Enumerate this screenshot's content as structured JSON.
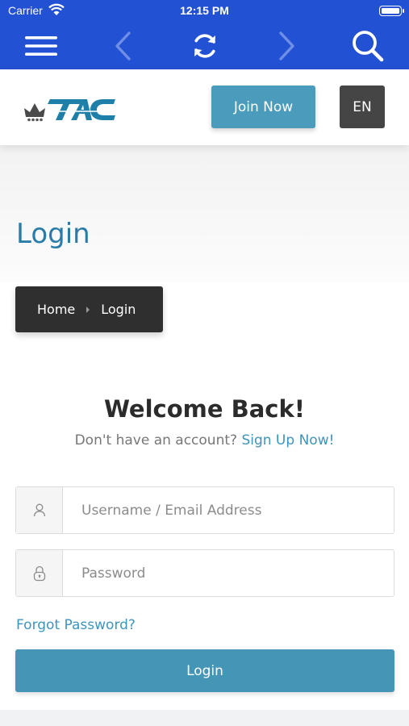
{
  "status_bar": {
    "carrier": "Carrier",
    "time": "12:15 PM"
  },
  "toolbar": {
    "icons": [
      "menu-icon",
      "back-icon",
      "refresh-icon",
      "forward-icon",
      "search-icon"
    ]
  },
  "header": {
    "logo_text": "TAC",
    "join_label": "Join Now",
    "language": "EN"
  },
  "banner": {
    "title": "Login",
    "breadcrumb": {
      "home": "Home",
      "current": "Login"
    }
  },
  "login": {
    "heading": "Welcome Back!",
    "prompt": "Don't have an account?",
    "signup_link": "Sign Up Now!",
    "username_placeholder": "Username / Email Address",
    "password_placeholder": "Password",
    "forgot_link": "Forgot Password?",
    "submit_label": "Login"
  },
  "colors": {
    "toolbar_blue": "#2351d4",
    "accent_teal": "#4a9bbc",
    "link_blue": "#3d94bd",
    "title_blue": "#2b7ba8",
    "dark": "#2f2f2f"
  }
}
